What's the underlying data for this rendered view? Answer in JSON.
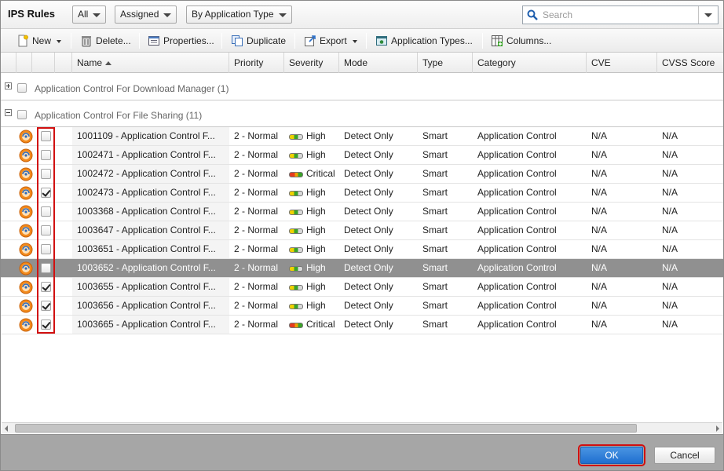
{
  "dialog": {
    "title": "IPS Rules",
    "filters": [
      "All",
      "Assigned",
      "By Application Type"
    ],
    "search_placeholder": "Search"
  },
  "toolbar": {
    "new_label": "New",
    "delete_label": "Delete...",
    "properties_label": "Properties...",
    "duplicate_label": "Duplicate",
    "export_label": "Export",
    "application_types_label": "Application Types...",
    "columns_label": "Columns..."
  },
  "columns": {
    "name": "Name",
    "priority": "Priority",
    "severity": "Severity",
    "mode": "Mode",
    "type": "Type",
    "category": "Category",
    "cve": "CVE",
    "cvss": "CVSS Score"
  },
  "groups": [
    {
      "label": "Application Control For Download Manager (1)",
      "expanded": false
    },
    {
      "label": "Application Control For File Sharing (11)",
      "expanded": true
    }
  ],
  "rows": [
    {
      "name": "1001109 - Application Control F...",
      "priority": "2 - Normal",
      "severity": "High",
      "mode": "Detect Only",
      "type": "Smart",
      "category": "Application Control",
      "cve": "N/A",
      "cvss": "N/A",
      "checked": false,
      "selected": false
    },
    {
      "name": "1002471 - Application Control F...",
      "priority": "2 - Normal",
      "severity": "High",
      "mode": "Detect Only",
      "type": "Smart",
      "category": "Application Control",
      "cve": "N/A",
      "cvss": "N/A",
      "checked": false,
      "selected": false
    },
    {
      "name": "1002472 - Application Control F...",
      "priority": "2 - Normal",
      "severity": "Critical",
      "mode": "Detect Only",
      "type": "Smart",
      "category": "Application Control",
      "cve": "N/A",
      "cvss": "N/A",
      "checked": false,
      "selected": false
    },
    {
      "name": "1002473 - Application Control F...",
      "priority": "2 - Normal",
      "severity": "High",
      "mode": "Detect Only",
      "type": "Smart",
      "category": "Application Control",
      "cve": "N/A",
      "cvss": "N/A",
      "checked": true,
      "selected": false
    },
    {
      "name": "1003368 - Application Control F...",
      "priority": "2 - Normal",
      "severity": "High",
      "mode": "Detect Only",
      "type": "Smart",
      "category": "Application Control",
      "cve": "N/A",
      "cvss": "N/A",
      "checked": false,
      "selected": false
    },
    {
      "name": "1003647 - Application Control F...",
      "priority": "2 - Normal",
      "severity": "High",
      "mode": "Detect Only",
      "type": "Smart",
      "category": "Application Control",
      "cve": "N/A",
      "cvss": "N/A",
      "checked": false,
      "selected": false
    },
    {
      "name": "1003651 - Application Control F...",
      "priority": "2 - Normal",
      "severity": "High",
      "mode": "Detect Only",
      "type": "Smart",
      "category": "Application Control",
      "cve": "N/A",
      "cvss": "N/A",
      "checked": false,
      "selected": false
    },
    {
      "name": "1003652 - Application Control F...",
      "priority": "2 - Normal",
      "severity": "High",
      "mode": "Detect Only",
      "type": "Smart",
      "category": "Application Control",
      "cve": "N/A",
      "cvss": "N/A",
      "checked": false,
      "selected": true
    },
    {
      "name": "1003655 - Application Control F...",
      "priority": "2 - Normal",
      "severity": "High",
      "mode": "Detect Only",
      "type": "Smart",
      "category": "Application Control",
      "cve": "N/A",
      "cvss": "N/A",
      "checked": true,
      "selected": false
    },
    {
      "name": "1003656 - Application Control F...",
      "priority": "2 - Normal",
      "severity": "High",
      "mode": "Detect Only",
      "type": "Smart",
      "category": "Application Control",
      "cve": "N/A",
      "cvss": "N/A",
      "checked": true,
      "selected": false
    },
    {
      "name": "1003665 - Application Control F...",
      "priority": "2 - Normal",
      "severity": "Critical",
      "mode": "Detect Only",
      "type": "Smart",
      "category": "Application Control",
      "cve": "N/A",
      "cvss": "N/A",
      "checked": true,
      "selected": false
    }
  ],
  "footer": {
    "ok_label": "OK",
    "cancel_label": "Cancel"
  },
  "icons": {
    "rule": "application-rule-icon",
    "search": "search-icon"
  },
  "colors": {
    "selected_row": "#909090",
    "ok_button": "#2b7ad6",
    "highlight_box": "#d11010"
  }
}
